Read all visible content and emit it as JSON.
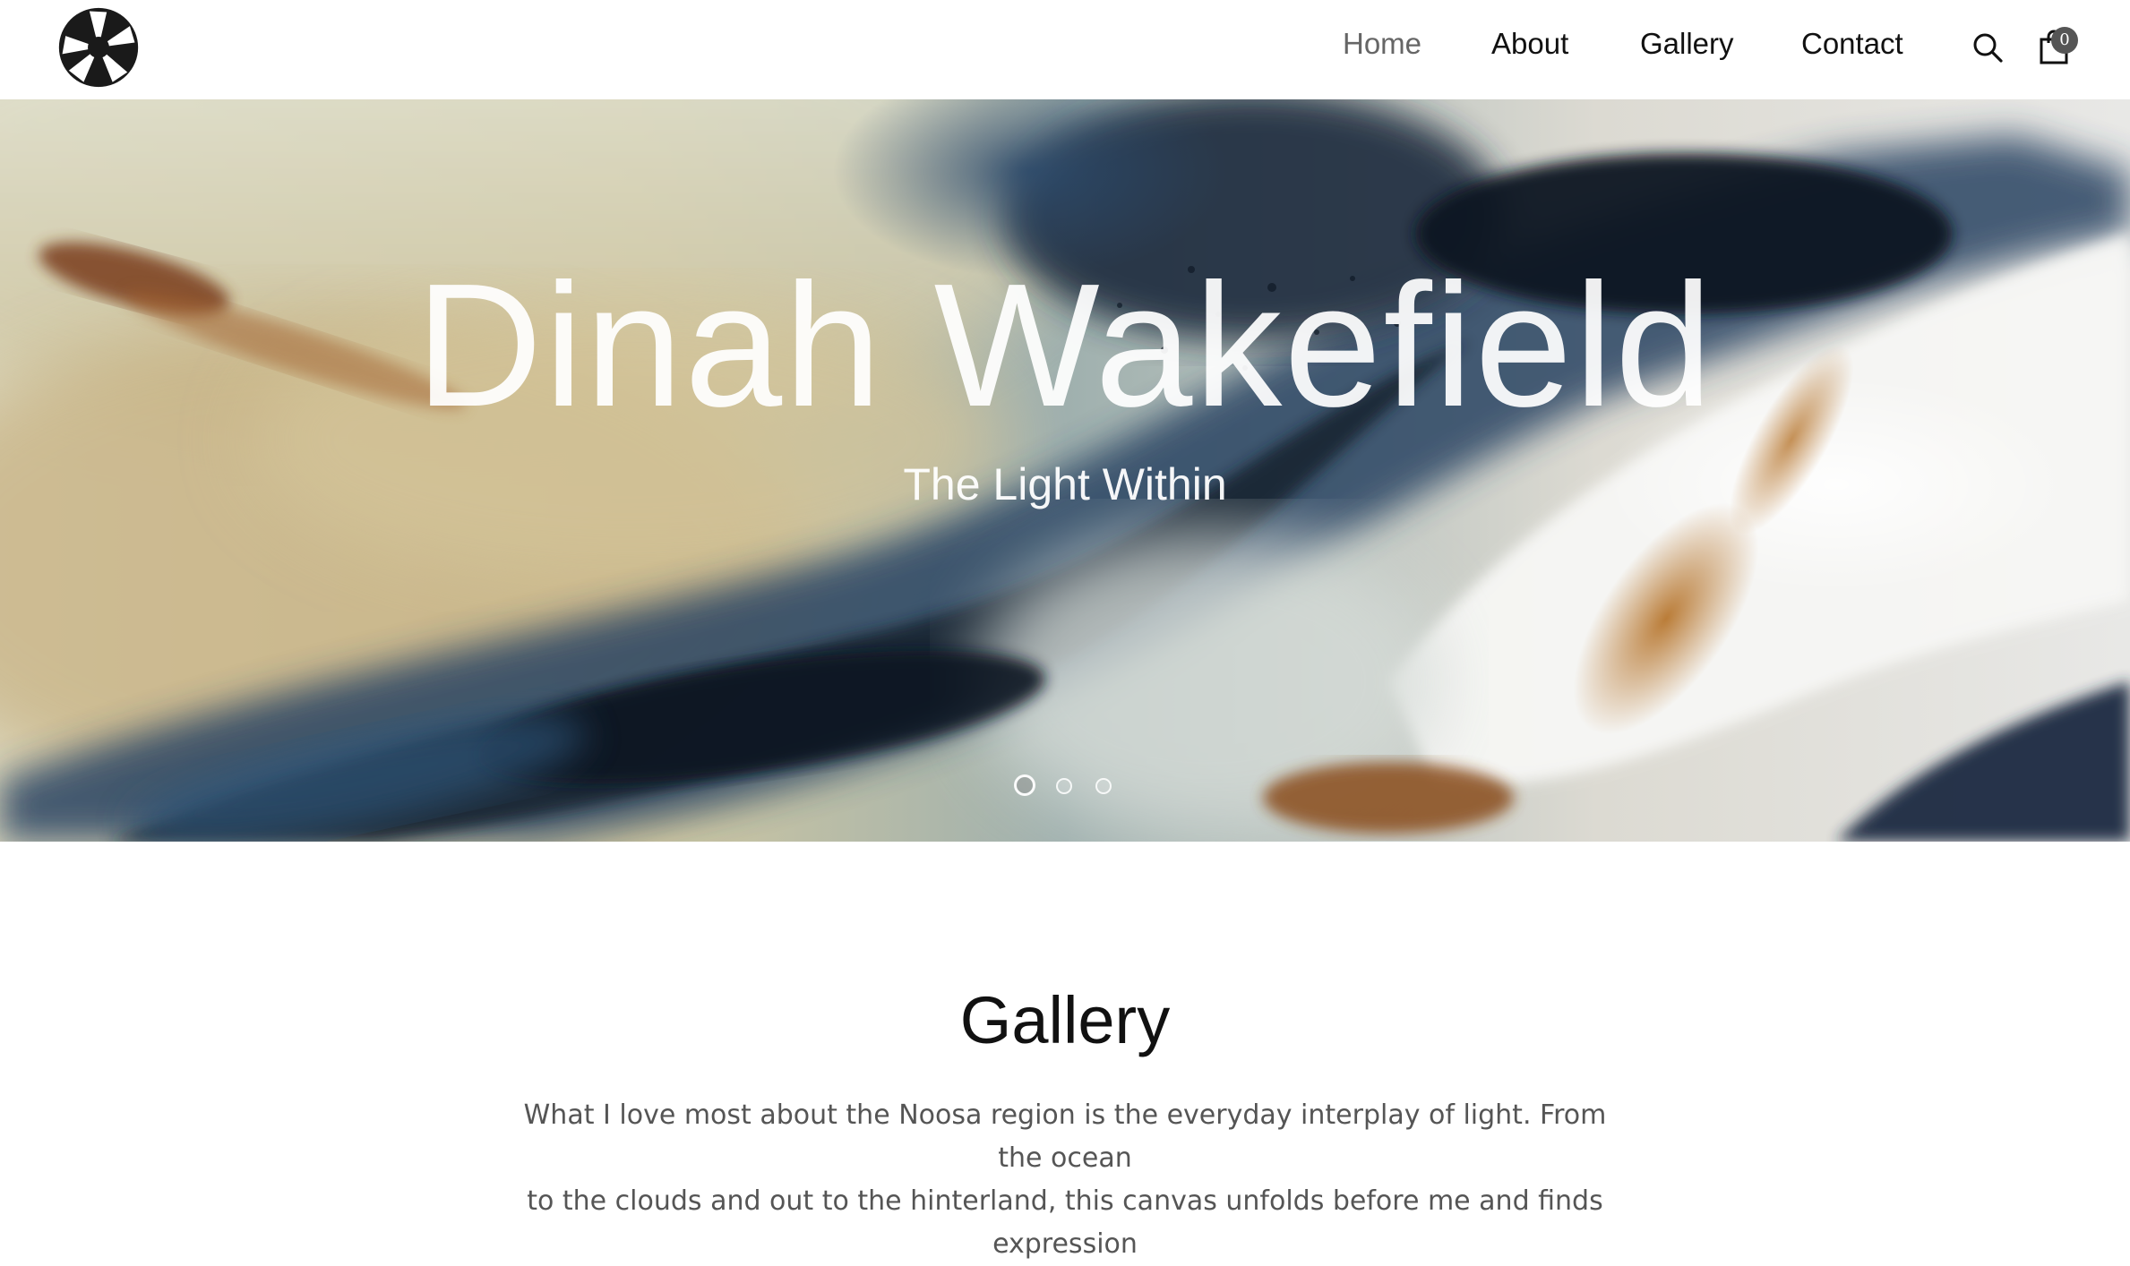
{
  "header": {
    "logo_icon": "camera-aperture-icon",
    "nav": [
      {
        "label": "Home",
        "active": true
      },
      {
        "label": "About",
        "active": false
      },
      {
        "label": "Gallery",
        "active": false
      },
      {
        "label": "Contact",
        "active": false
      }
    ],
    "search_icon": "search-icon",
    "cart_icon": "shopping-bag-icon",
    "cart_count": "0"
  },
  "hero": {
    "title": "Dinah Wakefield",
    "subtitle": "The Light Within",
    "slides_total": 3,
    "active_slide": 1
  },
  "gallery": {
    "title": "Gallery",
    "intro_line_1": "What I love most about the Noosa region is the everyday interplay of light. From the ocean",
    "intro_line_2": "to the clouds and out to the hinterland, this canvas unfolds before me  and finds expression"
  },
  "colors": {
    "text": "#111111",
    "nav_active": "#666666",
    "body_text": "#555555",
    "cart_badge": "#555555"
  }
}
